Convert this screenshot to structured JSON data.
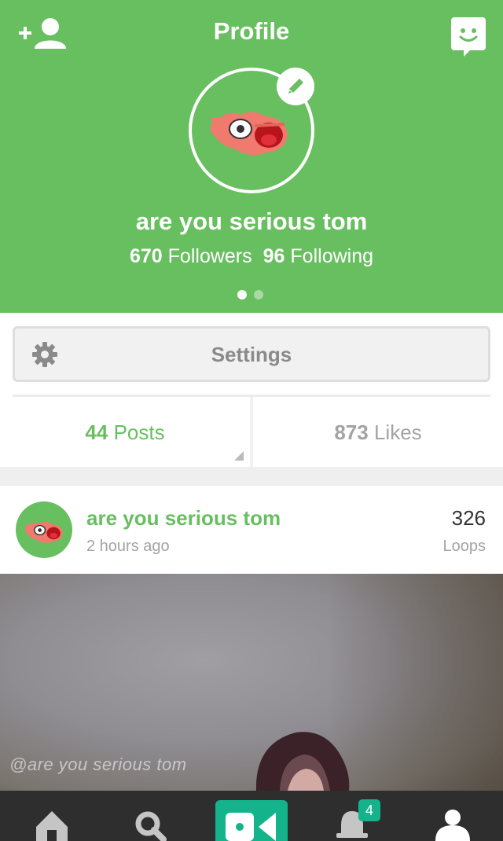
{
  "header": {
    "title": "Profile",
    "username": "are you serious tom",
    "followers_count": "670",
    "followers_label": "Followers",
    "following_count": "96",
    "following_label": "Following",
    "page_dots": 2,
    "active_dot": 1
  },
  "settings": {
    "label": "Settings"
  },
  "tabs": {
    "posts_count": "44",
    "posts_label": "Posts",
    "likes_count": "873",
    "likes_label": "Likes",
    "active": "posts"
  },
  "post": {
    "author": "are you serious tom",
    "time": "2 hours ago",
    "loops_count": "326",
    "loops_label": "Loops",
    "watermark": "@are you serious tom"
  },
  "bottom_nav": {
    "items": [
      "home-icon",
      "search-icon",
      "record-video-icon",
      "notifications-bell-icon",
      "profile-icon"
    ],
    "notification_badge": "4"
  },
  "colors": {
    "brand_green": "#68bf60",
    "accent_teal": "#14b38c",
    "nav_bg": "#2e2e2e"
  }
}
